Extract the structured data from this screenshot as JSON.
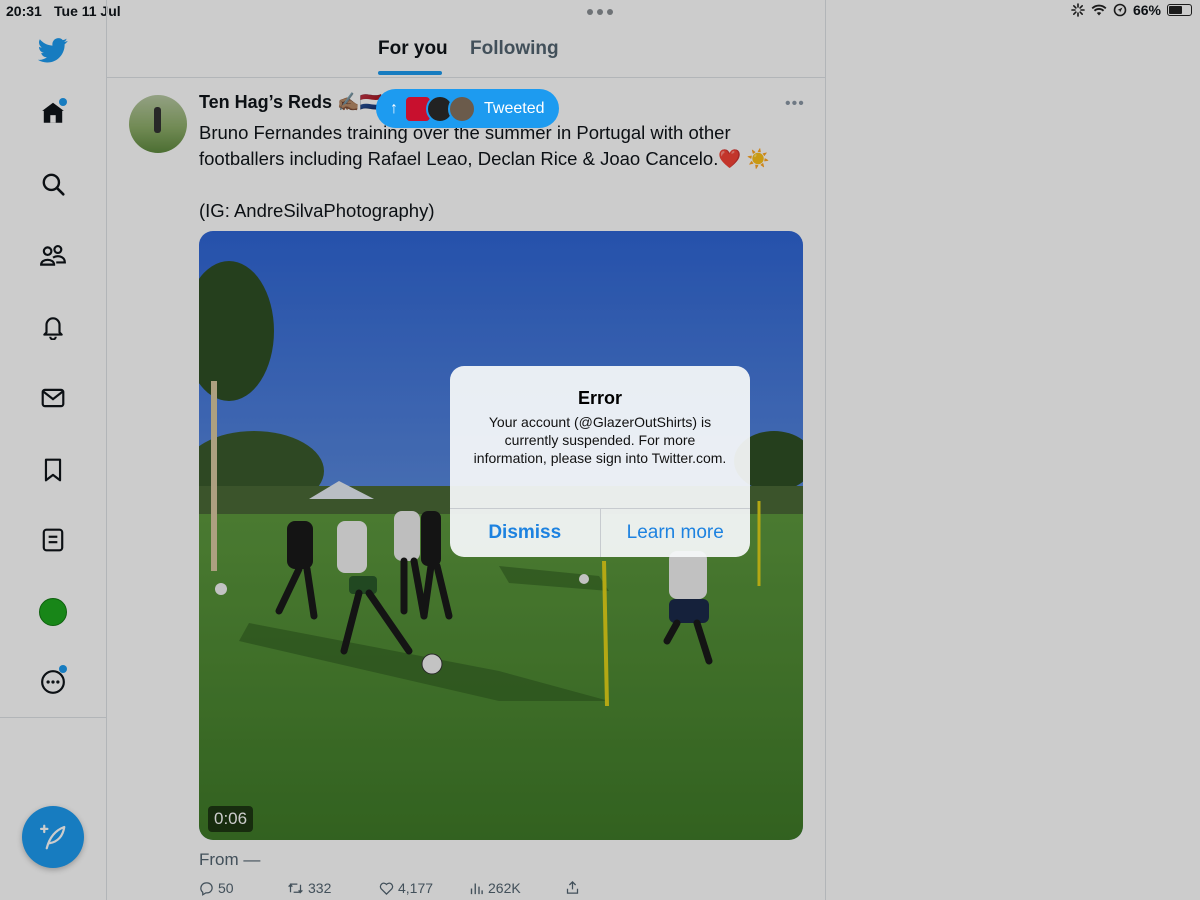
{
  "status_bar": {
    "time": "20:31",
    "date": "Tue 11 Jul",
    "battery": "66%",
    "battery_level": 0.66
  },
  "sidebar": {
    "items": [
      {
        "icon": "home-icon",
        "badge": true
      },
      {
        "icon": "search-icon",
        "badge": false
      },
      {
        "icon": "communities-icon",
        "badge": false
      },
      {
        "icon": "notifications-icon",
        "badge": false
      },
      {
        "icon": "messages-icon",
        "badge": false
      },
      {
        "icon": "bookmarks-icon",
        "badge": false
      },
      {
        "icon": "lists-icon",
        "badge": false
      },
      {
        "icon": "profile-avatar",
        "badge": false
      },
      {
        "icon": "more-icon",
        "badge": true
      }
    ],
    "compose_icon": "compose-icon"
  },
  "header": {
    "tabs": [
      {
        "label": "For you",
        "active": true
      },
      {
        "label": "Following",
        "active": false
      }
    ]
  },
  "new_tweets_pill": {
    "label": "Tweeted",
    "arrow": "↑"
  },
  "tweet": {
    "author": "Ten Hag’s Reds ✍🏽🇳🇱",
    "text_line1": "Bruno Fernandes training over the summer in Portugal with other footballers including Rafael Leao, Declan Rice & Joao Cancelo.❤️ ☀️",
    "text_line2": "(IG: AndreSilvaPhotography)",
    "video_duration": "0:06",
    "from_label": "From —",
    "stats": {
      "replies": "50",
      "retweets": "332",
      "likes": "4,177",
      "views": "262K"
    }
  },
  "alert": {
    "title": "Error",
    "message": "Your account (@GlazerOutShirts) is currently suspended. For more information, please sign into Twitter.com.",
    "dismiss_label": "Dismiss",
    "learn_more_label": "Learn more"
  },
  "colors": {
    "accent": "#1d9bf0",
    "alert_button": "#1d82e0",
    "text": "#0f1419",
    "muted": "#536471"
  }
}
